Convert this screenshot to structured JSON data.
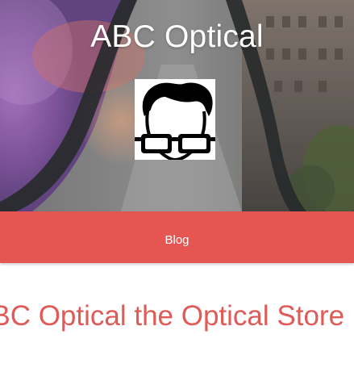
{
  "header": {
    "site_title": "ABC Optical",
    "logo_icon": "glasses-man-logo-icon"
  },
  "nav": {
    "items": [
      {
        "label": "Blog"
      }
    ]
  },
  "main": {
    "heading": "ABC Optical the Optical Store"
  },
  "colors": {
    "accent": "#e55653",
    "heading_text": "#e05a57",
    "nav_text": "#ffffff",
    "title_text": "#ffffff"
  }
}
